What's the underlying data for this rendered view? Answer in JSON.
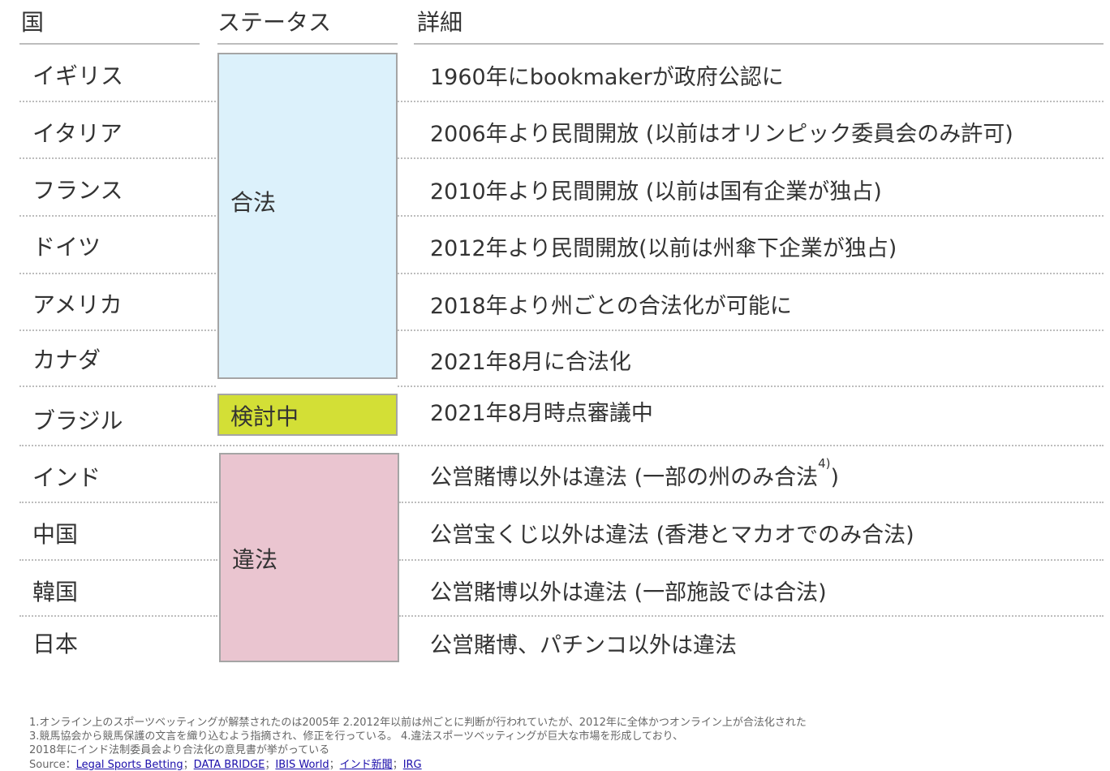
{
  "headers": {
    "country": "国",
    "status": "ステータス",
    "detail": "詳細"
  },
  "rows": [
    {
      "country": "イギリス",
      "detail": "1960年にbookmakerが政府公認に"
    },
    {
      "country": "イタリア",
      "detail": "2006年より民間開放 (以前はオリンピック委員会のみ許可)"
    },
    {
      "country": "フランス",
      "detail": "2010年より民間開放 (以前は国有企業が独占)"
    },
    {
      "country": "ドイツ",
      "detail": "2012年より民間開放(以前は州傘下企業が独占)"
    },
    {
      "country": "アメリカ",
      "detail": "2018年より州ごとの合法化が可能に"
    },
    {
      "country": "カナダ",
      "detail": "2021年8月に合法化"
    },
    {
      "country": "ブラジル",
      "detail": "2021年8月時点審議中"
    },
    {
      "country": "インド",
      "detail": "公営賭博以外は違法 (一部の州のみ合法",
      "detail_sup": "4)",
      "detail_tail": ")"
    },
    {
      "country": "中国",
      "detail": "公営宝くじ以外は違法 (香港とマカオでのみ合法)"
    },
    {
      "country": "韓国",
      "detail": "公営賭博以外は違法 (一部施設では合法)"
    },
    {
      "country": "日本",
      "detail": "公営賭博、パチンコ以外は違法"
    }
  ],
  "status_groups": {
    "legal": {
      "label": "合法",
      "color": "#dcf1fb"
    },
    "review": {
      "label": "検討中",
      "color": "#d3df36"
    },
    "illegal": {
      "label": "違法",
      "color": "#eac5d0"
    }
  },
  "footnotes": {
    "line1": "1.オンライン上のスポーツベッティングが解禁されたのは2005年 2.2012年以前は州ごとに判断が行われていたが、2012年に全体かつオンライン上が合法化された",
    "line2": "3.競馬協会から競馬保護の文言を織り込むよう指摘され、修正を行っている。 4.違法スポーツベッティングが巨大な市場を形成しており、",
    "line3": "2018年にインド法制委員会より合法化の意見書が挙がっている",
    "source_label": "Source：",
    "sources": [
      "Legal Sports Betting",
      "DATA BRIDGE",
      "IBIS World",
      "インド新聞",
      "IRG"
    ],
    "separator": "；"
  }
}
